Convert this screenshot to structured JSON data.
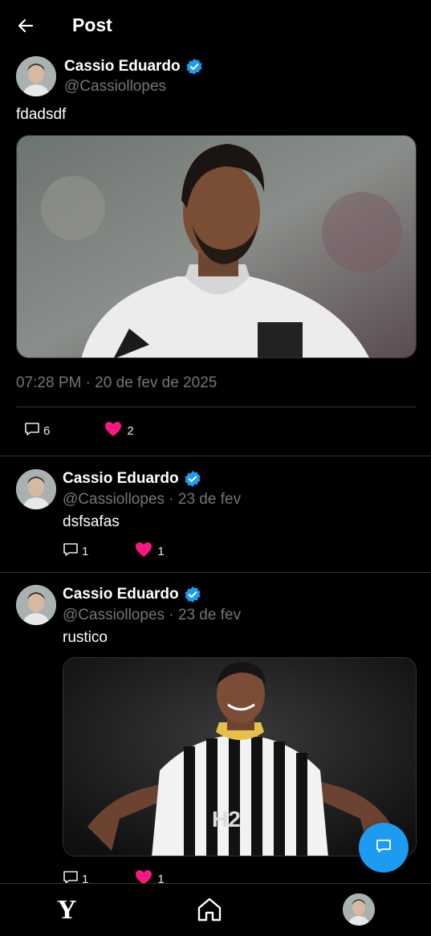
{
  "header": {
    "title": "Post"
  },
  "main_post": {
    "author_name": "Cassio Eduardo",
    "handle": "@Cassiollopes",
    "text": "fdadsdf",
    "timestamp": "07:28 PM · 20 de fev de 2025",
    "comments": "6",
    "likes": "2"
  },
  "replies": [
    {
      "author_name": "Cassio Eduardo",
      "meta": "@Cassiollopes · 23 de fev",
      "text": "dsfsafas",
      "comments": "1",
      "likes": "1"
    },
    {
      "author_name": "Cassio Eduardo",
      "meta": "@Cassiollopes · 23 de fev",
      "text": "rustico",
      "comments": "1",
      "likes": "1"
    }
  ],
  "bottom_nav": {
    "logo": "Y"
  },
  "colors": {
    "accent": "#1d9bf0",
    "like": "#f91880",
    "muted": "#71767b",
    "divider": "#2f3336"
  }
}
